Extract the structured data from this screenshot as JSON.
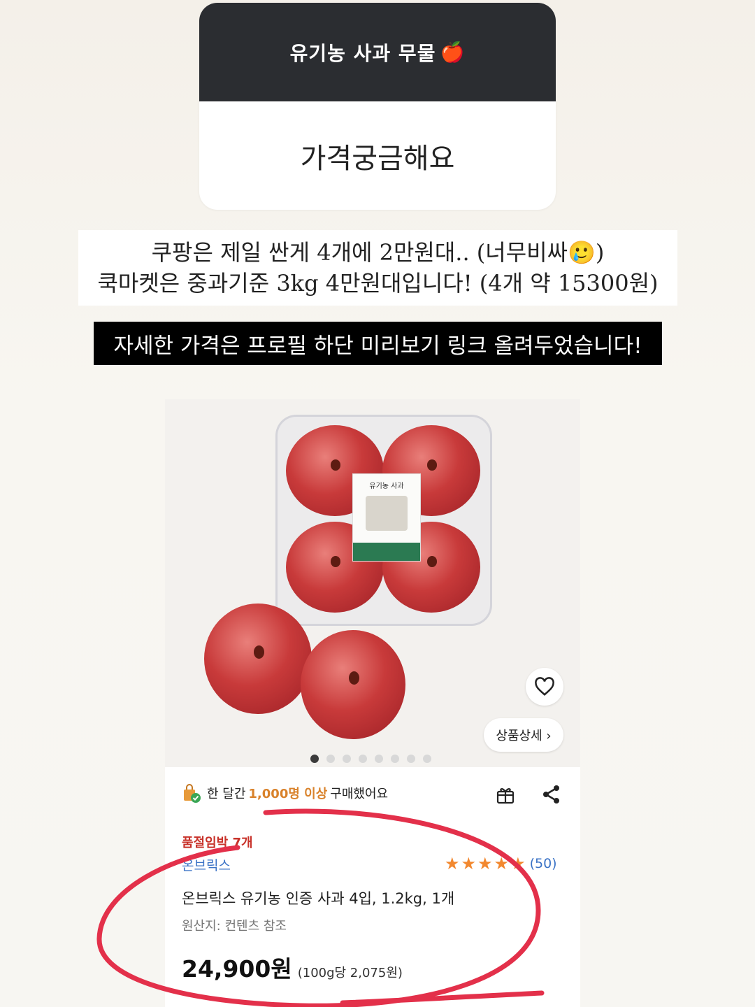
{
  "question_card": {
    "title": "유기농 사과 무물",
    "title_emoji": "🍎",
    "response": "가격궁금해요"
  },
  "answer": {
    "line1": "쿠팡은 제일 싼게 4개에 2만원대.. (너무비싸🥲)",
    "line2": "쿡마켓은 중과기준 3kg 4만원대입니다! (4개 약 15300원)"
  },
  "banner": "자세한 가격은 프로필 하단 미리보기 링크 올려두었습니다!",
  "product_image": {
    "label_title": "유기농 사과",
    "detail_button": "상품상세 ›",
    "dots_total": 8,
    "dots_active": 1
  },
  "product": {
    "bought_prefix": "한 달간",
    "bought_highlight": "1,000명 이상",
    "bought_suffix": "구매했어요",
    "soldout_notice": "품절임박 7개",
    "brand": "온브릭스",
    "rating_stars": 5,
    "review_count": "(50)",
    "name": "온브릭스 유기농 인증 사과 4입, 1.2kg, 1개",
    "origin": "원산지: 컨텐츠 참조",
    "price": "24,900원",
    "unit_price": "(100g당 2,075원)"
  },
  "colors": {
    "accent_orange": "#d9822b",
    "link_blue": "#3b73c6",
    "annotation_red": "#e3304a"
  }
}
